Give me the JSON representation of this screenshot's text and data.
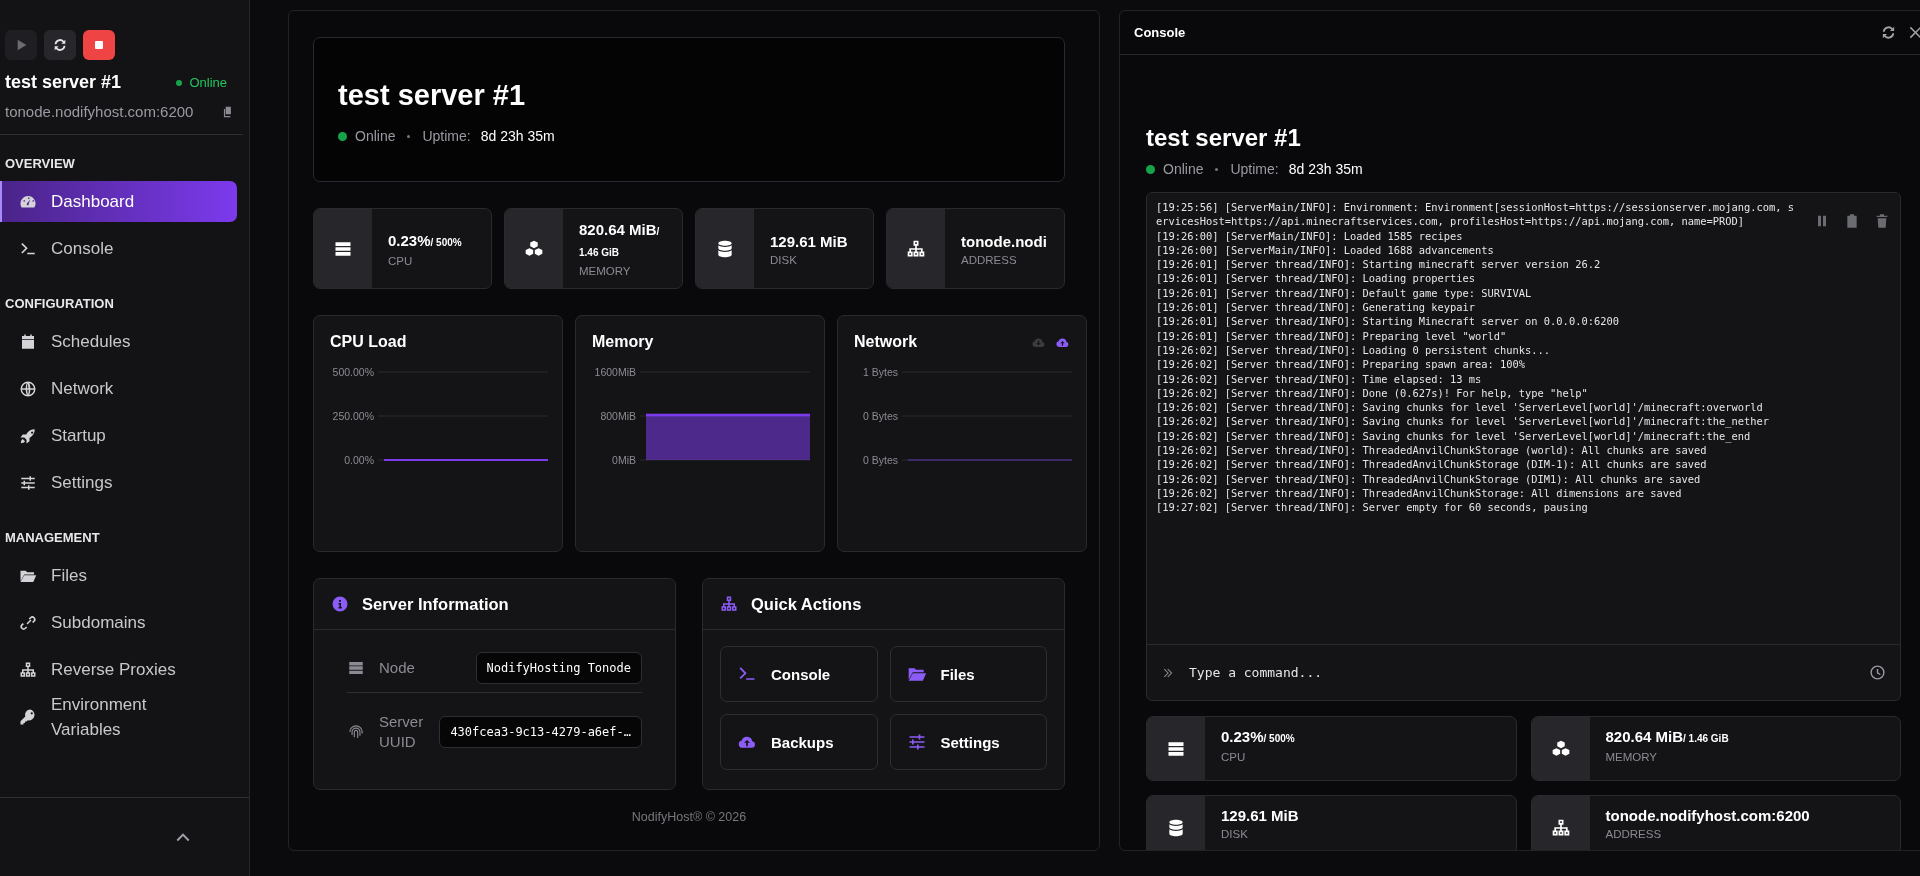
{
  "sidebar": {
    "controls": [
      {
        "kind": "start",
        "disabled": true
      },
      {
        "kind": "restart",
        "disabled": false
      },
      {
        "kind": "stop",
        "disabled": false
      }
    ],
    "server_name": "test server #1",
    "status": "Online",
    "online": true,
    "address": "tonode.nodifyhost.com:6200",
    "sections": [
      {
        "heading": "OVERVIEW",
        "items": [
          {
            "label": "Dashboard",
            "selected": true
          },
          {
            "label": "Console",
            "selected": false
          }
        ]
      },
      {
        "heading": "CONFIGURATION",
        "items": [
          {
            "label": "Schedules",
            "selected": false
          },
          {
            "label": "Network",
            "selected": false
          },
          {
            "label": "Startup",
            "selected": false
          },
          {
            "label": "Settings",
            "selected": false
          }
        ]
      },
      {
        "heading": "MANAGEMENT",
        "items": [
          {
            "label": "Files",
            "selected": false
          },
          {
            "label": "Subdomains",
            "selected": false
          },
          {
            "label": "Reverse Proxies",
            "selected": false
          },
          {
            "label": "Environment Variables",
            "selected": false
          }
        ]
      }
    ]
  },
  "main": {
    "hero": {
      "title": "test server #1",
      "status": "Online",
      "online": true,
      "uptime_label": "Uptime:",
      "uptime": "8d 23h 35m"
    },
    "stats": [
      {
        "value": "0.23%",
        "max": "/ 500%",
        "label": "CPU"
      },
      {
        "value": "820.64 MiB",
        "max": "/ 1.46 GiB",
        "label": "MEMORY"
      },
      {
        "value": "129.61 MiB",
        "label": "DISK"
      },
      {
        "value": "tonode.nodi",
        "label": "ADDRESS"
      }
    ],
    "charts": [
      {
        "chart_data": {
          "type": "line",
          "title": "CPU Load",
          "ylim": [
            0,
            500
          ],
          "yticks": [
            {
              "value": 0,
              "label": "0.00%"
            },
            {
              "value": 250,
              "label": "250.00%"
            },
            {
              "value": 500,
              "label": "500.00%"
            }
          ],
          "series": [
            {
              "color": "#7c3aed",
              "values": [
                0,
                0,
                0,
                0,
                0,
                0,
                0,
                0,
                0,
                0
              ]
            }
          ]
        }
      },
      {
        "chart_data": {
          "type": "area",
          "title": "Memory",
          "ylim": [
            0,
            1600
          ],
          "yticks": [
            {
              "value": 0,
              "label": "0MiB"
            },
            {
              "value": 800,
              "label": "800MiB"
            },
            {
              "value": 1600,
              "label": "1600MiB"
            }
          ],
          "series": [
            {
              "color": "#7c3aed",
              "values": [
                820,
                820,
                820,
                820,
                820,
                820,
                820,
                820,
                820,
                820
              ]
            }
          ]
        }
      },
      {
        "chart_data": {
          "type": "line",
          "title": "Network",
          "ylim": [
            0,
            1
          ],
          "yticks": [
            {
              "value": 0,
              "label": "0 Bytes"
            },
            {
              "value": 0.5,
              "label": "0 Bytes"
            },
            {
              "value": 1,
              "label": "1 Bytes"
            }
          ],
          "series": [
            {
              "color": "#3b2a66",
              "values": [
                0,
                0,
                0,
                0,
                0,
                0,
                0,
                0,
                0,
                0
              ]
            }
          ]
        }
      }
    ],
    "server_information": {
      "title": "Server Information",
      "rows": [
        {
          "label": "Node",
          "value": "NodifyHosting Tonode"
        },
        {
          "label": "Server UUID",
          "value": "430fcea3-9c13-4279-a6ef-…"
        }
      ]
    },
    "quick_actions": {
      "title": "Quick Actions",
      "buttons": [
        "Console",
        "Files",
        "Backups",
        "Settings"
      ]
    },
    "footer": "NodifyHost® © 2026"
  },
  "console": {
    "title": "Console",
    "server_name": "test server #1",
    "status": "Online",
    "online": true,
    "uptime_label": "Uptime:",
    "uptime": "8d 23h 35m",
    "log": [
      "[19:25:56] [ServerMain/INFO]: Environment: Environment[sessionHost=https://sessionserver.mojang.com, servicesHost=https://api.minecraftservices.com, profilesHost=https://api.mojang.com, name=PROD]",
      "[19:26:00] [ServerMain/INFO]: Loaded 1585 recipes",
      "[19:26:00] [ServerMain/INFO]: Loaded 1688 advancements",
      "[19:26:01] [Server thread/INFO]: Starting minecraft server version 26.2",
      "[19:26:01] [Server thread/INFO]: Loading properties",
      "[19:26:01] [Server thread/INFO]: Default game type: SURVIVAL",
      "[19:26:01] [Server thread/INFO]: Generating keypair",
      "[19:26:01] [Server thread/INFO]: Starting Minecraft server on 0.0.0.0:6200",
      "[19:26:01] [Server thread/INFO]: Preparing level \"world\"",
      "[19:26:02] [Server thread/INFO]: Loading 0 persistent chunks...",
      "[19:26:02] [Server thread/INFO]: Preparing spawn area: 100%",
      "[19:26:02] [Server thread/INFO]: Time elapsed: 13 ms",
      "[19:26:02] [Server thread/INFO]: Done (0.627s)! For help, type \"help\"",
      "[19:26:02] [Server thread/INFO]: Saving chunks for level 'ServerLevel[world]'/minecraft:overworld",
      "[19:26:02] [Server thread/INFO]: Saving chunks for level 'ServerLevel[world]'/minecraft:the_nether",
      "[19:26:02] [Server thread/INFO]: Saving chunks for level 'ServerLevel[world]'/minecraft:the_end",
      "[19:26:02] [Server thread/INFO]: ThreadedAnvilChunkStorage (world): All chunks are saved",
      "[19:26:02] [Server thread/INFO]: ThreadedAnvilChunkStorage (DIM-1): All chunks are saved",
      "[19:26:02] [Server thread/INFO]: ThreadedAnvilChunkStorage (DIM1): All chunks are saved",
      "[19:26:02] [Server thread/INFO]: ThreadedAnvilChunkStorage: All dimensions are saved",
      "[19:27:02] [Server thread/INFO]: Server empty for 60 seconds, pausing"
    ],
    "command": {
      "placeholder": "Type a command..."
    },
    "stats": [
      {
        "value": "0.23%",
        "max": "/ 500%",
        "label": "CPU"
      },
      {
        "value": "820.64 MiB",
        "max": "/ 1.46 GiB",
        "label": "MEMORY"
      },
      {
        "value": "129.61 MiB",
        "label": "DISK"
      },
      {
        "value": "tonode.nodifyhost.com:6200",
        "label": "ADDRESS"
      }
    ]
  }
}
